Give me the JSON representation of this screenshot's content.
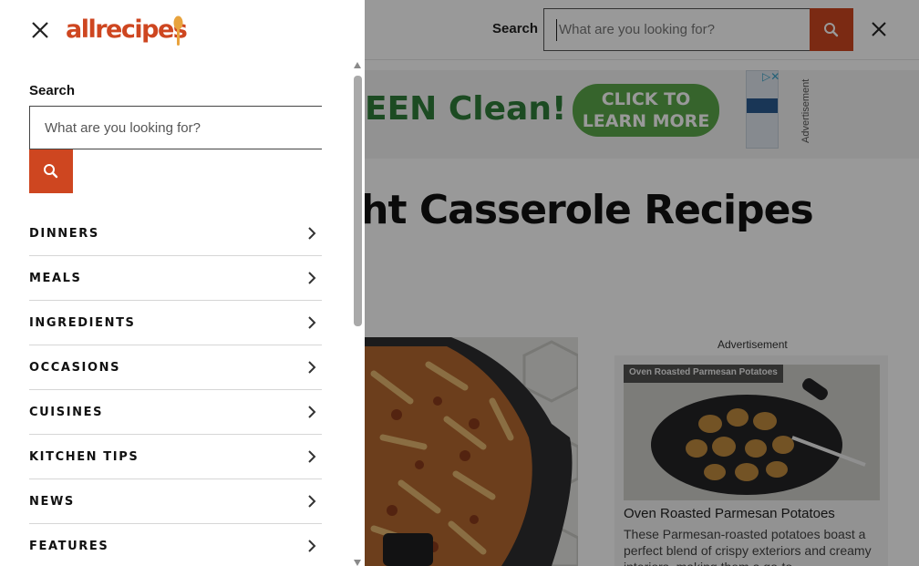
{
  "background_page": {
    "header": {
      "search_label": "Search",
      "search_placeholder": "What are you looking for?"
    },
    "ad_banner": {
      "headline": "EEN Clean!",
      "cta": "CLICK TO LEARN MORE",
      "label": "Advertisement"
    },
    "page_title": "knight Casserole Recipes",
    "side_ad_label": "Advertisement",
    "promo_card": {
      "image_tag": "Oven Roasted Parmesan Potatoes",
      "title": "Oven Roasted Parmesan Potatoes",
      "description": "These Parmesan-roasted potatoes boast a perfect blend of crispy exteriors and creamy interiors, making them a go-to"
    }
  },
  "drawer": {
    "logo_text": "allrecipes",
    "search_label": "Search",
    "search_placeholder": "What are you looking for?",
    "nav_items": [
      {
        "label": "DINNERS"
      },
      {
        "label": "MEALS"
      },
      {
        "label": "INGREDIENTS"
      },
      {
        "label": "OCCASIONS"
      },
      {
        "label": "CUISINES"
      },
      {
        "label": "KITCHEN TIPS"
      },
      {
        "label": "NEWS"
      },
      {
        "label": "FEATURES"
      }
    ]
  },
  "colors": {
    "brand": "#ce4620",
    "overlay": "rgba(0,0,0,0.40)"
  },
  "icons": {
    "close": "close-icon",
    "search": "search-icon",
    "chevron": "chevron-right-icon"
  }
}
